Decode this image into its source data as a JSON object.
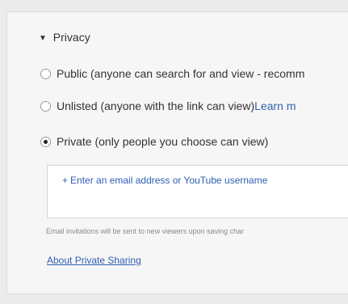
{
  "privacy": {
    "header_label": "Privacy",
    "options": [
      {
        "label": "Public (anyone can search for and view - recomm",
        "link": "",
        "selected": false
      },
      {
        "label": "Unlisted (anyone with the link can view) ",
        "link": "Learn m",
        "selected": false
      },
      {
        "label": "Private (only people you choose can view)",
        "link": "",
        "selected": true
      }
    ],
    "email_prompt": "Enter an email address or YouTube username",
    "email_note": "Email invitations will be sent to new viewers upon saving char",
    "about_link": "About Private Sharing"
  },
  "colors": {
    "link": "#2f5fb3",
    "text": "#333333",
    "panel_bg": "#f6f6f6",
    "page_bg": "#ebebeb"
  },
  "icons": {
    "expand": "triangle-down-icon",
    "add": "plus-icon"
  }
}
